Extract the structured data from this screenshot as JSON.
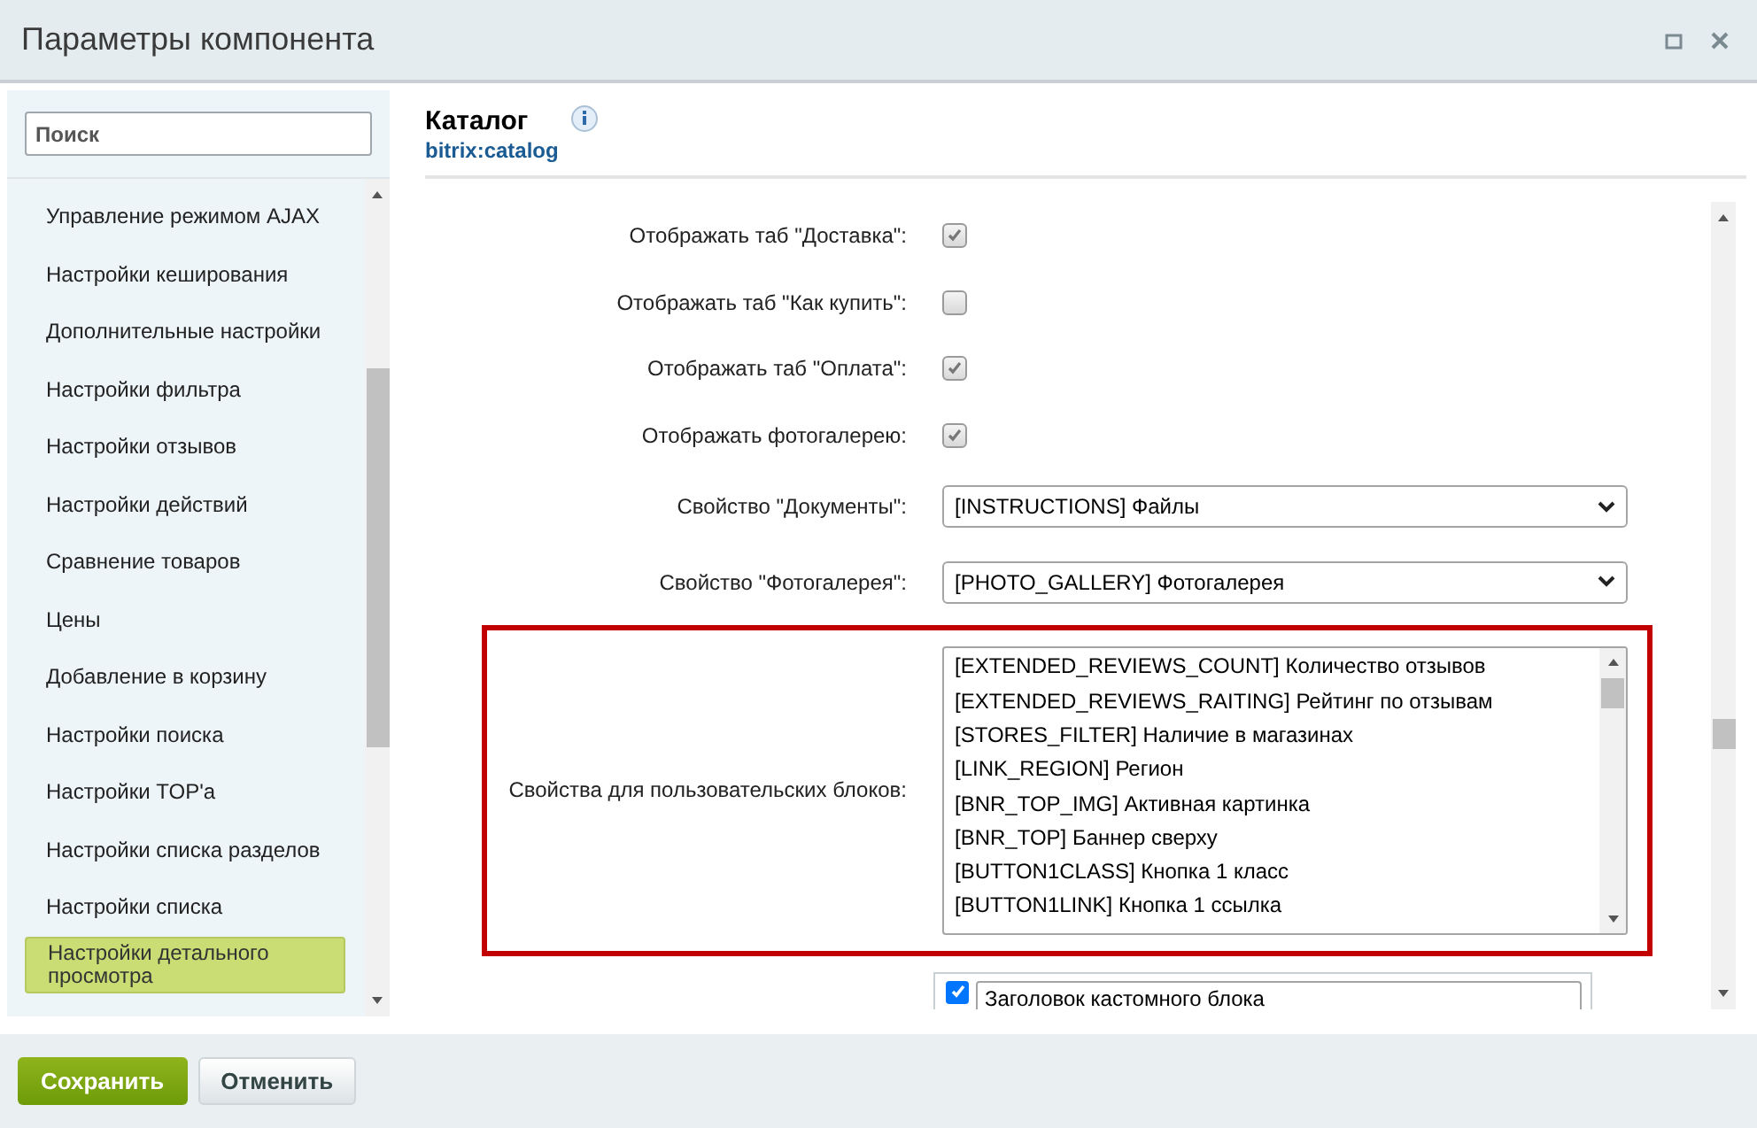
{
  "window": {
    "title": "Параметры компонента"
  },
  "sidebar": {
    "search": {
      "placeholder": "Поиск"
    },
    "items": [
      {
        "label": "Управление режимом AJAX",
        "selected": false
      },
      {
        "label": "Настройки кеширования",
        "selected": false
      },
      {
        "label": "Дополнительные настройки",
        "selected": false
      },
      {
        "label": "Настройки фильтра",
        "selected": false
      },
      {
        "label": "Настройки отзывов",
        "selected": false
      },
      {
        "label": "Настройки действий",
        "selected": false
      },
      {
        "label": "Сравнение товаров",
        "selected": false
      },
      {
        "label": "Цены",
        "selected": false
      },
      {
        "label": "Добавление в корзину",
        "selected": false
      },
      {
        "label": "Настройки поиска",
        "selected": false
      },
      {
        "label": "Настройки TOP'а",
        "selected": false
      },
      {
        "label": "Настройки списка разделов",
        "selected": false
      },
      {
        "label": "Настройки списка",
        "selected": false
      },
      {
        "label": "Настройки детального просмотра",
        "selected": true
      }
    ]
  },
  "component": {
    "title": "Каталог",
    "code": "bitrix:catalog"
  },
  "fields": [
    {
      "kind": "checkbox",
      "label": "Отображать таб \"Доставка\":",
      "checked": true
    },
    {
      "kind": "checkbox",
      "label": "Отображать таб \"Как купить\":",
      "checked": false
    },
    {
      "kind": "checkbox",
      "label": "Отображать таб \"Оплата\":",
      "checked": true
    },
    {
      "kind": "checkbox",
      "label": "Отображать фотогалерею:",
      "checked": true
    },
    {
      "kind": "select",
      "label": "Свойство \"Документы\":",
      "value": "[INSTRUCTIONS] Файлы"
    },
    {
      "kind": "select",
      "label": "Свойство \"Фотогалерея\":",
      "value": "[PHOTO_GALLERY] Фотогалерея"
    },
    {
      "kind": "multiselect",
      "label": "Свойства для пользовательских блоков:",
      "highlighted": true,
      "options": [
        "[EXTENDED_REVIEWS_COUNT] Количество отзывов",
        "[EXTENDED_REVIEWS_RAITING] Рейтинг по отзывам",
        "[STORES_FILTER] Наличие в магазинах",
        "[LINK_REGION] Регион",
        "[BNR_TOP_IMG] Активная картинка",
        "[BNR_TOP] Баннер сверху",
        "[BUTTON1CLASS] Кнопка 1 класс",
        "[BUTTON1LINK] Кнопка 1 ссылка"
      ]
    },
    {
      "kind": "custom",
      "checked": true,
      "value": "Заголовок кастомного блока"
    }
  ],
  "buttons": [
    {
      "kind": "primary",
      "label": "Сохранить"
    },
    {
      "kind": "secondary",
      "label": "Отменить"
    }
  ]
}
